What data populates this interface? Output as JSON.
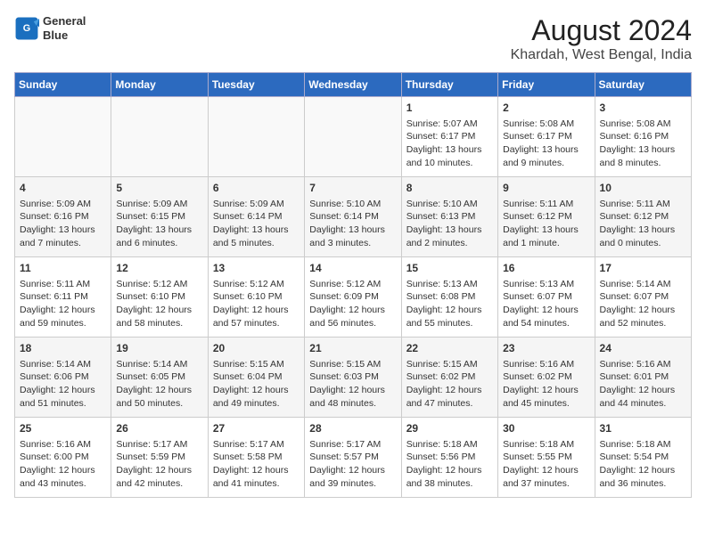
{
  "header": {
    "logo_line1": "General",
    "logo_line2": "Blue",
    "title": "August 2024",
    "subtitle": "Khardah, West Bengal, India"
  },
  "weekdays": [
    "Sunday",
    "Monday",
    "Tuesday",
    "Wednesday",
    "Thursday",
    "Friday",
    "Saturday"
  ],
  "weeks": [
    [
      {
        "day": "",
        "lines": []
      },
      {
        "day": "",
        "lines": []
      },
      {
        "day": "",
        "lines": []
      },
      {
        "day": "",
        "lines": []
      },
      {
        "day": "1",
        "lines": [
          "Sunrise: 5:07 AM",
          "Sunset: 6:17 PM",
          "Daylight: 13 hours",
          "and 10 minutes."
        ]
      },
      {
        "day": "2",
        "lines": [
          "Sunrise: 5:08 AM",
          "Sunset: 6:17 PM",
          "Daylight: 13 hours",
          "and 9 minutes."
        ]
      },
      {
        "day": "3",
        "lines": [
          "Sunrise: 5:08 AM",
          "Sunset: 6:16 PM",
          "Daylight: 13 hours",
          "and 8 minutes."
        ]
      }
    ],
    [
      {
        "day": "4",
        "lines": [
          "Sunrise: 5:09 AM",
          "Sunset: 6:16 PM",
          "Daylight: 13 hours",
          "and 7 minutes."
        ]
      },
      {
        "day": "5",
        "lines": [
          "Sunrise: 5:09 AM",
          "Sunset: 6:15 PM",
          "Daylight: 13 hours",
          "and 6 minutes."
        ]
      },
      {
        "day": "6",
        "lines": [
          "Sunrise: 5:09 AM",
          "Sunset: 6:14 PM",
          "Daylight: 13 hours",
          "and 5 minutes."
        ]
      },
      {
        "day": "7",
        "lines": [
          "Sunrise: 5:10 AM",
          "Sunset: 6:14 PM",
          "Daylight: 13 hours",
          "and 3 minutes."
        ]
      },
      {
        "day": "8",
        "lines": [
          "Sunrise: 5:10 AM",
          "Sunset: 6:13 PM",
          "Daylight: 13 hours",
          "and 2 minutes."
        ]
      },
      {
        "day": "9",
        "lines": [
          "Sunrise: 5:11 AM",
          "Sunset: 6:12 PM",
          "Daylight: 13 hours",
          "and 1 minute."
        ]
      },
      {
        "day": "10",
        "lines": [
          "Sunrise: 5:11 AM",
          "Sunset: 6:12 PM",
          "Daylight: 13 hours",
          "and 0 minutes."
        ]
      }
    ],
    [
      {
        "day": "11",
        "lines": [
          "Sunrise: 5:11 AM",
          "Sunset: 6:11 PM",
          "Daylight: 12 hours",
          "and 59 minutes."
        ]
      },
      {
        "day": "12",
        "lines": [
          "Sunrise: 5:12 AM",
          "Sunset: 6:10 PM",
          "Daylight: 12 hours",
          "and 58 minutes."
        ]
      },
      {
        "day": "13",
        "lines": [
          "Sunrise: 5:12 AM",
          "Sunset: 6:10 PM",
          "Daylight: 12 hours",
          "and 57 minutes."
        ]
      },
      {
        "day": "14",
        "lines": [
          "Sunrise: 5:12 AM",
          "Sunset: 6:09 PM",
          "Daylight: 12 hours",
          "and 56 minutes."
        ]
      },
      {
        "day": "15",
        "lines": [
          "Sunrise: 5:13 AM",
          "Sunset: 6:08 PM",
          "Daylight: 12 hours",
          "and 55 minutes."
        ]
      },
      {
        "day": "16",
        "lines": [
          "Sunrise: 5:13 AM",
          "Sunset: 6:07 PM",
          "Daylight: 12 hours",
          "and 54 minutes."
        ]
      },
      {
        "day": "17",
        "lines": [
          "Sunrise: 5:14 AM",
          "Sunset: 6:07 PM",
          "Daylight: 12 hours",
          "and 52 minutes."
        ]
      }
    ],
    [
      {
        "day": "18",
        "lines": [
          "Sunrise: 5:14 AM",
          "Sunset: 6:06 PM",
          "Daylight: 12 hours",
          "and 51 minutes."
        ]
      },
      {
        "day": "19",
        "lines": [
          "Sunrise: 5:14 AM",
          "Sunset: 6:05 PM",
          "Daylight: 12 hours",
          "and 50 minutes."
        ]
      },
      {
        "day": "20",
        "lines": [
          "Sunrise: 5:15 AM",
          "Sunset: 6:04 PM",
          "Daylight: 12 hours",
          "and 49 minutes."
        ]
      },
      {
        "day": "21",
        "lines": [
          "Sunrise: 5:15 AM",
          "Sunset: 6:03 PM",
          "Daylight: 12 hours",
          "and 48 minutes."
        ]
      },
      {
        "day": "22",
        "lines": [
          "Sunrise: 5:15 AM",
          "Sunset: 6:02 PM",
          "Daylight: 12 hours",
          "and 47 minutes."
        ]
      },
      {
        "day": "23",
        "lines": [
          "Sunrise: 5:16 AM",
          "Sunset: 6:02 PM",
          "Daylight: 12 hours",
          "and 45 minutes."
        ]
      },
      {
        "day": "24",
        "lines": [
          "Sunrise: 5:16 AM",
          "Sunset: 6:01 PM",
          "Daylight: 12 hours",
          "and 44 minutes."
        ]
      }
    ],
    [
      {
        "day": "25",
        "lines": [
          "Sunrise: 5:16 AM",
          "Sunset: 6:00 PM",
          "Daylight: 12 hours",
          "and 43 minutes."
        ]
      },
      {
        "day": "26",
        "lines": [
          "Sunrise: 5:17 AM",
          "Sunset: 5:59 PM",
          "Daylight: 12 hours",
          "and 42 minutes."
        ]
      },
      {
        "day": "27",
        "lines": [
          "Sunrise: 5:17 AM",
          "Sunset: 5:58 PM",
          "Daylight: 12 hours",
          "and 41 minutes."
        ]
      },
      {
        "day": "28",
        "lines": [
          "Sunrise: 5:17 AM",
          "Sunset: 5:57 PM",
          "Daylight: 12 hours",
          "and 39 minutes."
        ]
      },
      {
        "day": "29",
        "lines": [
          "Sunrise: 5:18 AM",
          "Sunset: 5:56 PM",
          "Daylight: 12 hours",
          "and 38 minutes."
        ]
      },
      {
        "day": "30",
        "lines": [
          "Sunrise: 5:18 AM",
          "Sunset: 5:55 PM",
          "Daylight: 12 hours",
          "and 37 minutes."
        ]
      },
      {
        "day": "31",
        "lines": [
          "Sunrise: 5:18 AM",
          "Sunset: 5:54 PM",
          "Daylight: 12 hours",
          "and 36 minutes."
        ]
      }
    ]
  ]
}
